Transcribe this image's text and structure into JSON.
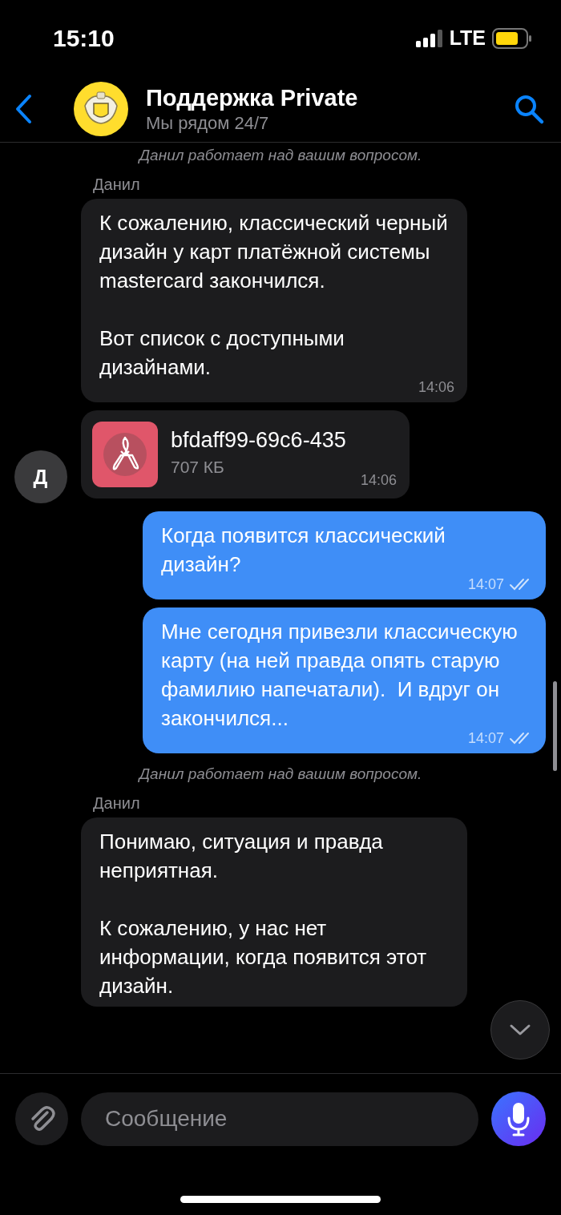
{
  "status_bar": {
    "time": "15:10",
    "network": "LTE"
  },
  "header": {
    "title": "Поддержка Private",
    "subtitle": "Мы рядом 24/7"
  },
  "messages": [
    {
      "kind": "system",
      "text": "Данил работает над вашим вопросом."
    },
    {
      "kind": "sender",
      "text": "Данил"
    },
    {
      "kind": "incoming",
      "text": "К сожалению, классический черный дизайн у карт платёжной системы mastercard закончился.\n\nВот список с доступными дизайнами.",
      "time": "14:06"
    },
    {
      "kind": "file",
      "file_name": "bfdaff99-69c6-435",
      "size": "707 КБ",
      "time": "14:06",
      "avatar": "Д"
    },
    {
      "kind": "outgoing",
      "text": "Когда появится классический дизайн?",
      "time": "14:07",
      "read": true
    },
    {
      "kind": "outgoing",
      "text": "Мне сегодня привезли классическую карту (на ней правда опять старую фамилию напечатали).  И вдруг он закончился...",
      "time": "14:07",
      "read": true
    },
    {
      "kind": "system",
      "text": "Данил работает над вашим вопросом."
    },
    {
      "kind": "sender",
      "text": "Данил"
    },
    {
      "kind": "incoming",
      "text": "Понимаю, ситуация и правда неприятная.\n\nК сожалению, у нас нет информации, когда появится этот дизайн."
    }
  ],
  "composer": {
    "placeholder": "Сообщение"
  }
}
